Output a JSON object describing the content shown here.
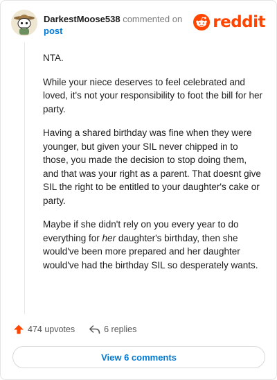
{
  "comment": {
    "username": "DarkestMoose538",
    "commented_text": "commented on",
    "target": "post",
    "paragraphs": [
      {
        "text": "NTA."
      },
      {
        "text": "While your niece deserves to feel celebrated and loved, it's not your responsibility to foot the bill for her party."
      },
      {
        "text": "Having a shared birthday was fine when they were younger, but given your SIL never chipped in to those, you made the decision to stop doing them, and that was your right as a parent. That doesnt give SIL the right to be entitled to your daughter's cake or party."
      },
      {
        "before": "Maybe if she didn't rely on you every year to do everything for ",
        "emph": "her",
        "after": " daughter's birthday, then she would've been more prepared and her daughter would've had the birthday SIL so desperately wants."
      }
    ]
  },
  "brand": {
    "name": "reddit",
    "icon": "reddit-alien-icon",
    "color": "#ff4500"
  },
  "actions": {
    "upvotes": "474 upvotes",
    "replies": "6 replies",
    "view_comments": "View 6 comments"
  },
  "colors": {
    "accent": "#ff4500",
    "link": "#0079d3"
  }
}
